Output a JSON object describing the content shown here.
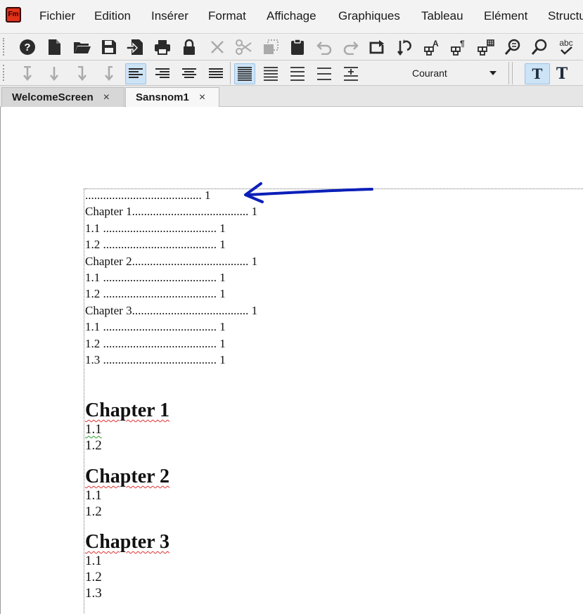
{
  "app": {
    "logo": "Fm"
  },
  "menu": [
    "Fichier",
    "Edition",
    "Insérer",
    "Format",
    "Affichage",
    "Graphiques",
    "Tableau",
    "Elément",
    "Structure"
  ],
  "toolbar2": {
    "paragraph_format": "Courant"
  },
  "tabs": [
    {
      "label": "WelcomeScreen",
      "close": "×"
    },
    {
      "label": "Sansnom1",
      "close": "×"
    }
  ],
  "toc": [
    {
      "text": "....................................... 1"
    },
    {
      "text": "Chapter 1....................................... 1"
    },
    {
      "text": "1.1 ...................................... 1"
    },
    {
      "text": "1.2 ...................................... 1"
    },
    {
      "text": "Chapter 2....................................... 1"
    },
    {
      "text": "1.1 ...................................... 1"
    },
    {
      "text": "1.2 ...................................... 1"
    },
    {
      "text": "Chapter 3....................................... 1"
    },
    {
      "text": "1.1 ...................................... 1"
    },
    {
      "text": "1.2 ...................................... 1"
    },
    {
      "text": "1.3 ...................................... 1"
    }
  ],
  "chapters": [
    {
      "title": "Chapter 1",
      "items": [
        "1.1",
        "1.2"
      ]
    },
    {
      "title": "Chapter 2",
      "items": [
        "1.1",
        "1.2"
      ]
    },
    {
      "title": "Chapter 3",
      "items": [
        "1.1",
        "1.2",
        "1.3"
      ]
    }
  ],
  "colors": {
    "annotation_arrow": "#0b1fb8",
    "spell_error": "#e03030"
  }
}
